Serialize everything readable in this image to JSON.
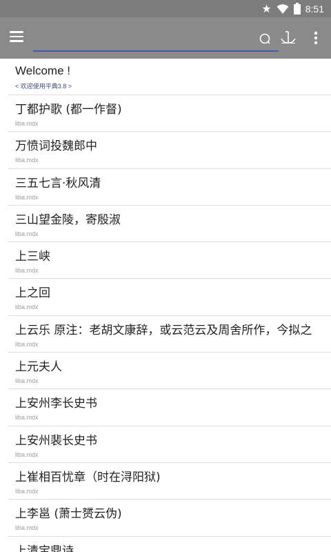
{
  "status_bar": {
    "time": "8:51",
    "icons": [
      "star-icon",
      "wifi-icon",
      "battery-icon"
    ]
  },
  "toolbar": {
    "menu_icon": "hamburger-menu-icon",
    "search_value": "",
    "search_placeholder": "",
    "search_icon": "search-icon",
    "anchor_icon": "anchor-icon",
    "more_icon": "more-vertical-icon",
    "colors": {
      "toolbar_bg": "#8a8a8a",
      "status_bg": "#7c7c7c",
      "search_underline": "#3f5fae"
    }
  },
  "welcome": {
    "title": "Welcome !",
    "subtitle": "< 欢迎使用平典3.8 >"
  },
  "entries": [
    {
      "title": "丁都护歌 (都一作督)",
      "source": "liba.mdx"
    },
    {
      "title": "万愤词投魏郎中",
      "source": "liba.mdx"
    },
    {
      "title": "三五七言·秋风清",
      "source": "liba.mdx"
    },
    {
      "title": "三山望金陵，寄殷淑",
      "source": "liba.mdx"
    },
    {
      "title": "上三峡",
      "source": "liba.mdx"
    },
    {
      "title": "上之回",
      "source": "liba.mdx"
    },
    {
      "title": "上云乐 原注：老胡文康辞，或云范云及周舍所作，今拟之",
      "source": "liba.mdx"
    },
    {
      "title": "上元夫人",
      "source": "liba.mdx"
    },
    {
      "title": "上安州李长史书",
      "source": "liba.mdx"
    },
    {
      "title": "上安州裴长史书",
      "source": "liba.mdx"
    },
    {
      "title": "上崔相百忧章（时在浔阳狱)",
      "source": "liba.mdx"
    },
    {
      "title": "上李邕 (萧士赟云伪)",
      "source": "liba.mdx"
    },
    {
      "title": "上清宝鼎诗",
      "source": ""
    }
  ]
}
